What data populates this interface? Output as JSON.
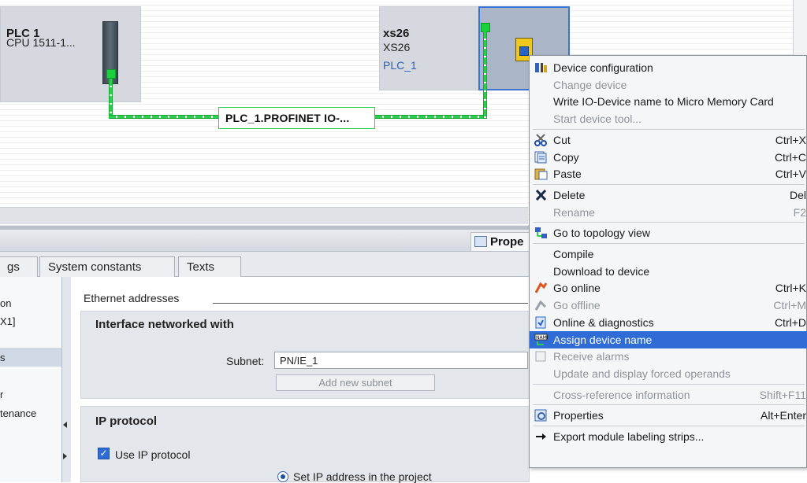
{
  "network_view": {
    "plc_box": {
      "name": "PLC 1",
      "model": "CPU 1511-1..."
    },
    "xs26_box": {
      "name": "xs26",
      "type": "XS26",
      "controller_link": "PLC_1"
    },
    "network_label": "PLC_1.PROFINET IO-..."
  },
  "properties_pane": {
    "pane_tab": "Prope",
    "tabs": [
      "gs",
      "System constants",
      "Texts"
    ],
    "nav_items": [
      "on",
      "X1]",
      "s",
      "r",
      "tenance"
    ],
    "ethernet_heading": "Ethernet addresses",
    "interface_section": {
      "title": "Interface networked with",
      "subnet_label": "Subnet:",
      "subnet_value": "PN/IE_1",
      "add_subnet_button": "Add new subnet"
    },
    "ip_section": {
      "title": "IP protocol",
      "use_ip_label": "Use IP protocol",
      "use_ip_checked": true,
      "set_ip_label": "Set IP address in the project"
    }
  },
  "context_menu": {
    "items": [
      {
        "label": "Device configuration",
        "shortcut": "",
        "enabled": true,
        "icon": "device-config-icon"
      },
      {
        "label": "Change device",
        "shortcut": "",
        "enabled": false,
        "icon": ""
      },
      {
        "label": "Write IO-Device name to Micro Memory Card",
        "shortcut": "",
        "enabled": true,
        "icon": ""
      },
      {
        "label": "Start device tool...",
        "shortcut": "",
        "enabled": false,
        "icon": ""
      },
      {
        "separator": true
      },
      {
        "label": "Cut",
        "shortcut": "Ctrl+X",
        "enabled": true,
        "icon": "scissors-icon"
      },
      {
        "label": "Copy",
        "shortcut": "Ctrl+C",
        "enabled": true,
        "icon": "copy-icon"
      },
      {
        "label": "Paste",
        "shortcut": "Ctrl+V",
        "enabled": true,
        "icon": "paste-icon"
      },
      {
        "separator": true
      },
      {
        "label": "Delete",
        "shortcut": "Del",
        "enabled": true,
        "icon": "delete-x-icon"
      },
      {
        "label": "Rename",
        "shortcut": "F2",
        "enabled": false,
        "icon": ""
      },
      {
        "separator": true
      },
      {
        "label": "Go to topology view",
        "shortcut": "",
        "enabled": true,
        "icon": "topology-icon"
      },
      {
        "separator": true
      },
      {
        "label": "Compile",
        "shortcut": "",
        "enabled": true,
        "icon": ""
      },
      {
        "label": "Download to device",
        "shortcut": "",
        "enabled": true,
        "icon": ""
      },
      {
        "label": "Go online",
        "shortcut": "Ctrl+K",
        "enabled": true,
        "icon": "go-online-icon"
      },
      {
        "label": "Go offline",
        "shortcut": "Ctrl+M",
        "enabled": false,
        "icon": "go-offline-icon"
      },
      {
        "label": "Online & diagnostics",
        "shortcut": "Ctrl+D",
        "enabled": true,
        "icon": "diagnostics-icon"
      },
      {
        "label": "Assign device name",
        "shortcut": "",
        "enabled": true,
        "icon": "assign-name-icon",
        "highlighted": true
      },
      {
        "label": "Receive alarms",
        "shortcut": "",
        "enabled": false,
        "icon": "checkbox-icon"
      },
      {
        "label": "Update and display forced operands",
        "shortcut": "",
        "enabled": false,
        "icon": ""
      },
      {
        "separator": true
      },
      {
        "label": "Cross-reference information",
        "shortcut": "Shift+F11",
        "enabled": false,
        "icon": ""
      },
      {
        "separator": true
      },
      {
        "label": "Properties",
        "shortcut": "Alt+Enter",
        "enabled": true,
        "icon": "properties-icon"
      },
      {
        "separator": true
      },
      {
        "label": "Export module labeling strips...",
        "shortcut": "",
        "enabled": true,
        "icon": "export-arrow-icon"
      }
    ]
  },
  "colors": {
    "highlight": "#2f6cd6",
    "network_green": "#2ccf4b",
    "device_bg": "#d5d9df",
    "selected_border": "#3a73d1"
  }
}
